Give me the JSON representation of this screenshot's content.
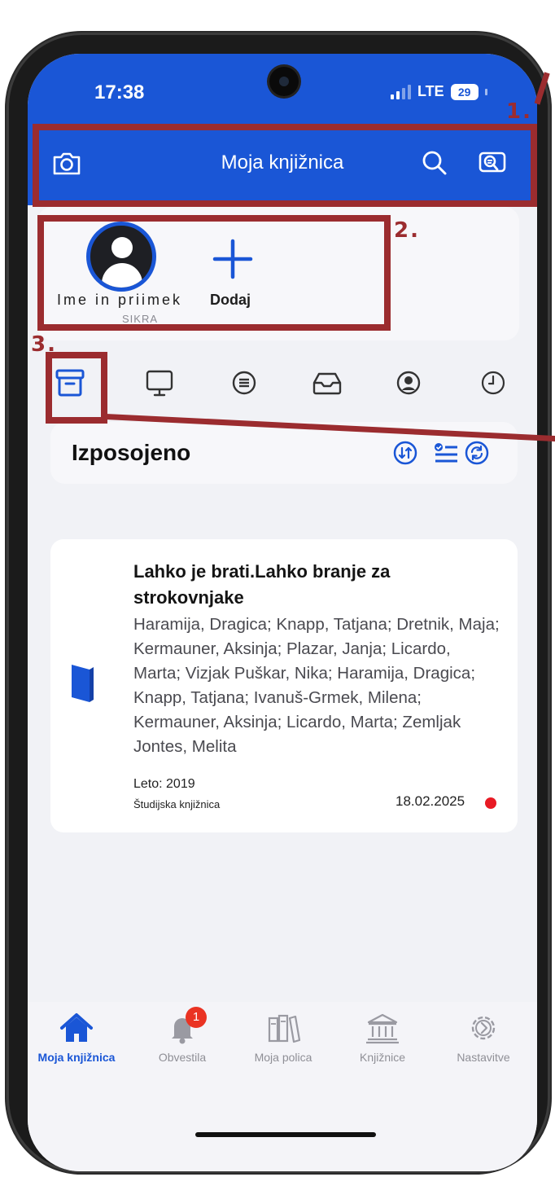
{
  "status_bar": {
    "time": "17:38",
    "network": "LTE",
    "battery": "29"
  },
  "header": {
    "title": "Moja knjižnica"
  },
  "profile": {
    "name": "Ime in priimek",
    "subtitle": "SIKRA",
    "add_label": "Dodaj"
  },
  "tabs": [
    {
      "icon": "archive-icon",
      "active": true
    },
    {
      "icon": "monitor-icon"
    },
    {
      "icon": "coins-icon"
    },
    {
      "icon": "inbox-icon"
    },
    {
      "icon": "user-circle-icon"
    },
    {
      "icon": "clock-icon"
    }
  ],
  "section": {
    "title": "Izposojeno"
  },
  "book": {
    "title": "Lahko je brati.Lahko branje za strokovnjake",
    "authors": "Haramija, Dragica; Knapp, Tatjana; Dretnik, Maja; Kermauner, Aksinja; Plazar, Janja; Licardo, Marta; Vizjak Puškar, Nika; Haramija, Dragica; Knapp, Tatjana; Ivanuš-Grmek, Milena; Kermauner, Aksinja; Licardo, Marta; Zemljak Jontes, Melita",
    "year": "Leto: 2019",
    "library": "Študijska knjižnica",
    "due_date": "18.02.2025",
    "status_color": "#e81a24"
  },
  "bottom_nav": {
    "items": [
      {
        "label": "Moja knjižnica",
        "icon": "home-icon",
        "active": true
      },
      {
        "label": "Obvestila",
        "icon": "bell-icon",
        "badge": "1"
      },
      {
        "label": "Moja polica",
        "icon": "bookshelf-icon"
      },
      {
        "label": "Knjižnice",
        "icon": "library-building-icon"
      },
      {
        "label": "Nastavitve",
        "icon": "settings-icon"
      }
    ]
  },
  "annotations": {
    "n1": "1.",
    "n2": "2.",
    "n3": "3."
  },
  "colors": {
    "primary": "#1a56d6",
    "annotation": "#9b2c2f",
    "background": "#f1f2f6"
  }
}
